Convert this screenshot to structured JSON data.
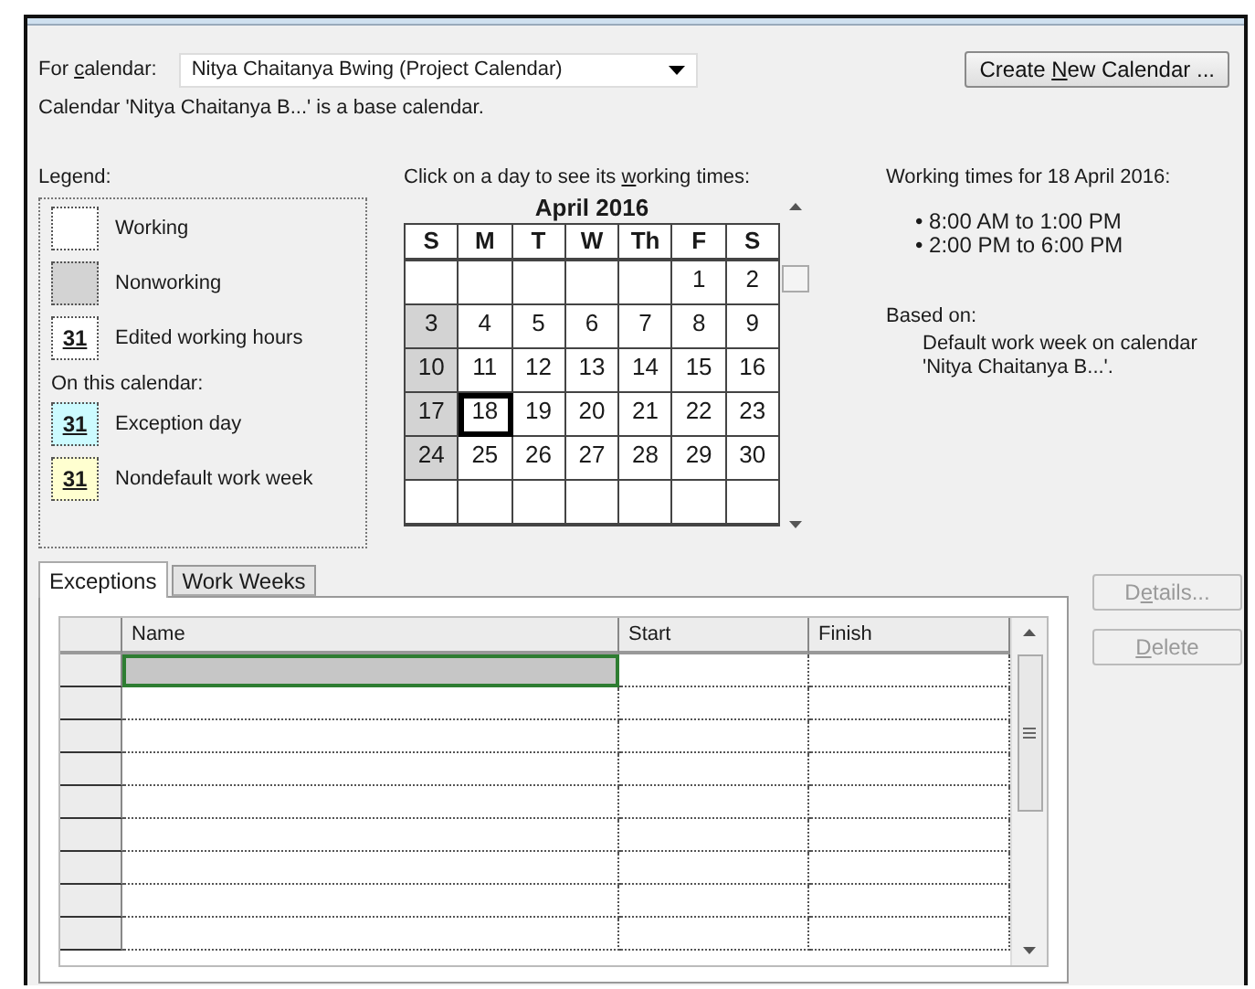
{
  "for_calendar": {
    "label_parts": [
      "For ",
      "c",
      "alendar:"
    ],
    "value": "Nitya Chaitanya Bwing (Project Calendar)"
  },
  "create_button": {
    "label_parts": [
      "Create ",
      "N",
      "ew Calendar ..."
    ]
  },
  "base_note": "Calendar 'Nitya Chaitanya B...' is a base calendar.",
  "legend": {
    "label": "Legend:",
    "items": [
      {
        "kind": "working",
        "text": "Working"
      },
      {
        "kind": "nonworking",
        "text": "Nonworking"
      },
      {
        "kind": "edited",
        "sample": "31",
        "text": "Edited working hours"
      },
      {
        "kind": "heading",
        "text": "On this calendar:"
      },
      {
        "kind": "exception",
        "sample": "31",
        "text": "Exception day"
      },
      {
        "kind": "nondefault",
        "sample": "31",
        "text": "Nondefault work week"
      }
    ]
  },
  "calendar": {
    "prompt_parts": [
      "Click on a day to see its ",
      "w",
      "orking times:"
    ],
    "month": "April 2016",
    "weekdays": [
      "S",
      "M",
      "T",
      "W",
      "Th",
      "F",
      "S"
    ],
    "weeks": [
      [
        {
          "nonworking": false
        },
        {
          "nonworking": false
        },
        {
          "nonworking": false
        },
        {
          "nonworking": false
        },
        {
          "nonworking": false
        },
        {
          "day": "1",
          "nonworking": false,
          "selected": false
        },
        {
          "day": "2",
          "nonworking": false,
          "selected": false
        }
      ],
      [
        {
          "day": "3",
          "nonworking": true,
          "selected": false
        },
        {
          "day": "4",
          "nonworking": false,
          "selected": false
        },
        {
          "day": "5",
          "nonworking": false,
          "selected": false
        },
        {
          "day": "6",
          "nonworking": false,
          "selected": false
        },
        {
          "day": "7",
          "nonworking": false,
          "selected": false
        },
        {
          "day": "8",
          "nonworking": false,
          "selected": false
        },
        {
          "day": "9",
          "nonworking": false,
          "selected": false
        }
      ],
      [
        {
          "day": "10",
          "nonworking": true,
          "selected": false
        },
        {
          "day": "11",
          "nonworking": false,
          "selected": false
        },
        {
          "day": "12",
          "nonworking": false,
          "selected": false
        },
        {
          "day": "13",
          "nonworking": false,
          "selected": false
        },
        {
          "day": "14",
          "nonworking": false,
          "selected": false
        },
        {
          "day": "15",
          "nonworking": false,
          "selected": false
        },
        {
          "day": "16",
          "nonworking": false,
          "selected": false
        }
      ],
      [
        {
          "day": "17",
          "nonworking": true,
          "selected": false
        },
        {
          "day": "18",
          "nonworking": false,
          "selected": true
        },
        {
          "day": "19",
          "nonworking": false,
          "selected": false
        },
        {
          "day": "20",
          "nonworking": false,
          "selected": false
        },
        {
          "day": "21",
          "nonworking": false,
          "selected": false
        },
        {
          "day": "22",
          "nonworking": false,
          "selected": false
        },
        {
          "day": "23",
          "nonworking": false,
          "selected": false
        }
      ],
      [
        {
          "day": "24",
          "nonworking": true,
          "selected": false
        },
        {
          "day": "25",
          "nonworking": false,
          "selected": false
        },
        {
          "day": "26",
          "nonworking": false,
          "selected": false
        },
        {
          "day": "27",
          "nonworking": false,
          "selected": false
        },
        {
          "day": "28",
          "nonworking": false,
          "selected": false
        },
        {
          "day": "29",
          "nonworking": false,
          "selected": false
        },
        {
          "day": "30",
          "nonworking": false,
          "selected": false
        }
      ],
      [
        {
          "nonworking": false
        },
        {
          "nonworking": false
        },
        {
          "nonworking": false
        },
        {
          "nonworking": false
        },
        {
          "nonworking": false
        },
        {
          "nonworking": false
        },
        {
          "nonworking": false
        }
      ]
    ]
  },
  "working_times": {
    "title": "Working times for 18 April 2016:",
    "times": [
      "• 8:00 AM to 1:00 PM",
      "• 2:00 PM to 6:00 PM"
    ],
    "based_on_label": "Based on:",
    "based_on_text": "Default work week on calendar 'Nitya Chaitanya B...'."
  },
  "tabs": [
    {
      "label": "Exceptions",
      "selected": true
    },
    {
      "label": "Work Weeks",
      "selected": false
    }
  ],
  "exceptions_table": {
    "columns": [
      "Name",
      "Start",
      "Finish"
    ],
    "rows": [
      {
        "selected": true
      },
      {
        "selected": false
      },
      {
        "selected": false
      },
      {
        "selected": false
      },
      {
        "selected": false
      },
      {
        "selected": false
      },
      {
        "selected": false
      },
      {
        "selected": false
      },
      {
        "selected": false
      }
    ]
  },
  "side_buttons": [
    {
      "label_parts": [
        "D",
        "e",
        "tails..."
      ],
      "disabled": true
    },
    {
      "label_parts": [
        "D",
        "elete"
      ],
      "disabled": true
    }
  ]
}
